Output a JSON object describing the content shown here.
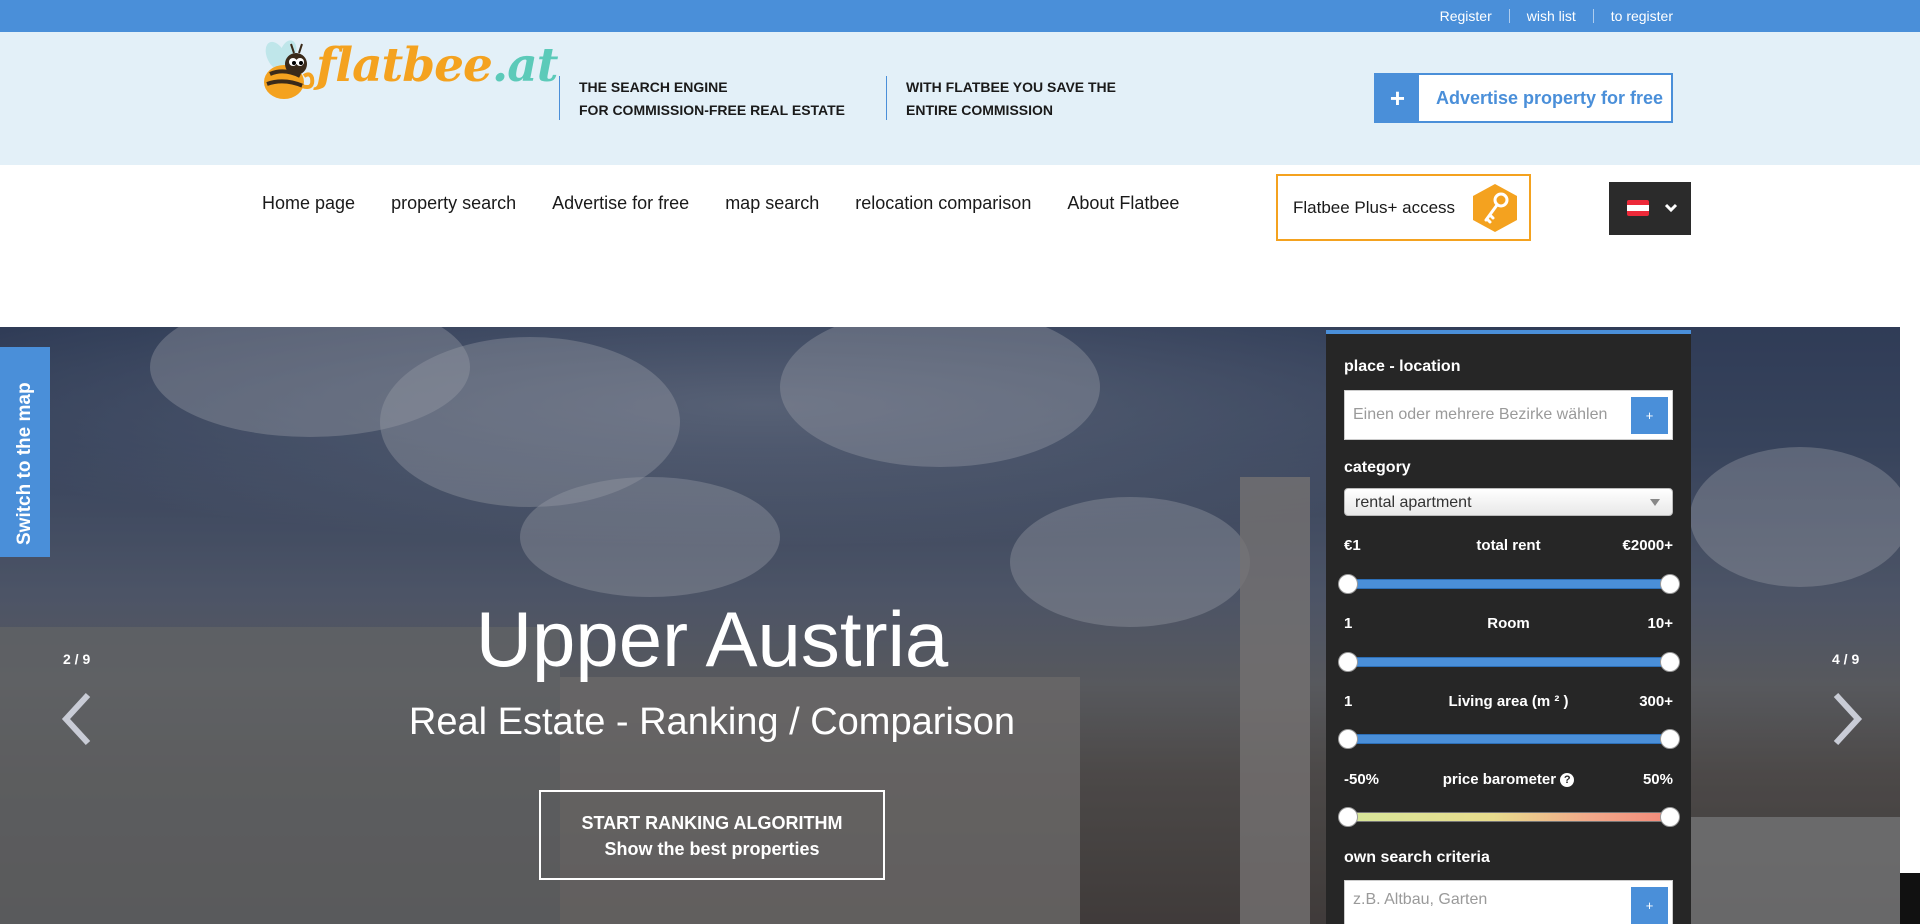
{
  "topbar": {
    "links": [
      "Register",
      "wish list",
      "to register"
    ]
  },
  "header": {
    "logo_main": "flatbee",
    "logo_tld": ".at",
    "tagline1": [
      "THE SEARCH ENGINE",
      "FOR COMMISSION-FREE REAL ESTATE"
    ],
    "tagline2": [
      "WITH FLATBEE YOU SAVE THE",
      "ENTIRE COMMISSION"
    ],
    "advertise_plus": "+",
    "advertise_label": "Advertise property for free"
  },
  "nav": {
    "items": [
      "Home page",
      "property search",
      "Advertise for free",
      "map search",
      "relocation comparison",
      "About Flatbee"
    ],
    "plus_access": "Flatbee Plus+ access"
  },
  "hero": {
    "page_left": "2 / 9",
    "page_right": "4 / 9",
    "title": "Upper Austria",
    "subtitle": "Real Estate - Ranking / Comparison",
    "cta_line1": "START RANKING ALGORITHM",
    "cta_line2": "Show the best properties",
    "switch_map": "Switch to the map"
  },
  "search": {
    "place_label": "place - location",
    "place_placeholder": "Einen oder mehrere Bezirke wählen",
    "add_symbol": "+",
    "category_label": "category",
    "category_value": "rental apartment",
    "rent": {
      "min": "€1",
      "label": "total rent",
      "max": "€2000+",
      "low": 0.0,
      "high": 1.0
    },
    "room": {
      "min": "1",
      "label": "Room",
      "max": "10+",
      "low": 0.0,
      "high": 1.0
    },
    "area": {
      "min": "1",
      "label": "Living area (m ² )",
      "max": "300+",
      "low": 0.0,
      "high": 1.0
    },
    "baro": {
      "min": "-50%",
      "label": "price barometer",
      "help": "?",
      "max": "50%",
      "low": 0.0,
      "high": 1.0
    },
    "own_label": "own search criteria",
    "own_placeholder": "z.B. Altbau, Garten"
  },
  "colors": {
    "brand_blue": "#4a8fd9",
    "brand_orange": "#f4a21f",
    "panel_bg": "#262626"
  }
}
